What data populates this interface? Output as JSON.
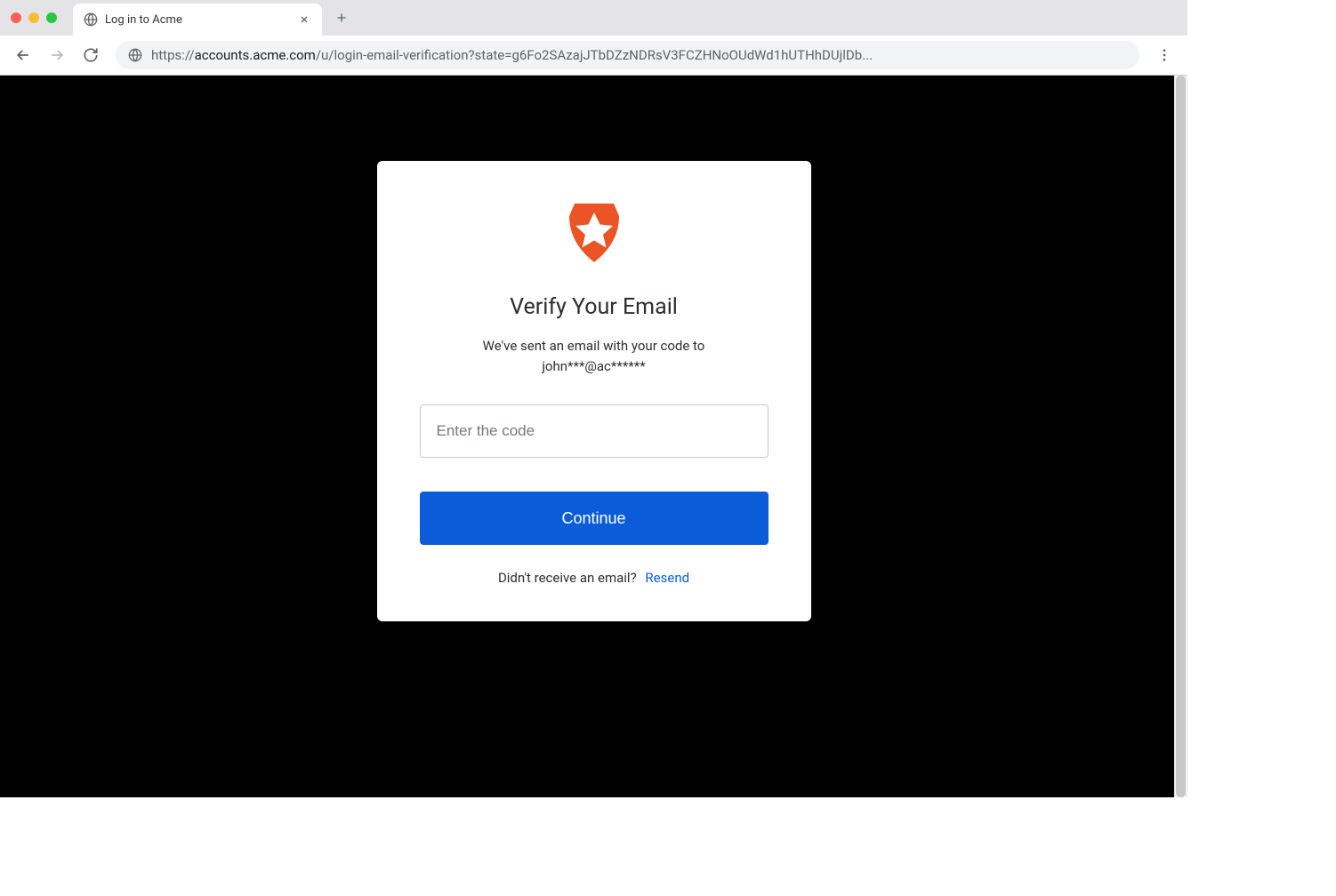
{
  "browser": {
    "tab_title": "Log in to Acme",
    "url_protocol": "https://",
    "url_host": "accounts.acme.com",
    "url_path": "/u/login-email-verification?state=g6Fo2SAzajJTbDZzNDRsV3FCZHNoOUdWd1hUTHhDUjlDb..."
  },
  "card": {
    "heading": "Verify Your Email",
    "subtext_line1": "We've sent an email with your code to",
    "subtext_line2": "john***@ac******",
    "code_placeholder": "Enter the code",
    "continue_label": "Continue",
    "resend_prompt": "Didn't receive an email?",
    "resend_action": "Resend"
  },
  "colors": {
    "primary": "#0b5cd8",
    "logo": "#eb5424"
  }
}
